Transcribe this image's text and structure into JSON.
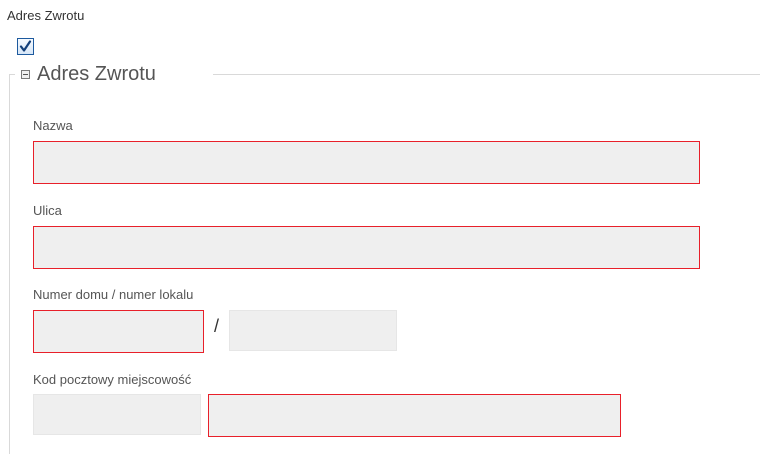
{
  "header": {
    "checkbox_label": "Adres Zwrotu",
    "checkbox_checked": true
  },
  "fieldset": {
    "legend": "Adres Zwrotu",
    "fields": {
      "nazwa": {
        "label": "Nazwa",
        "value": "",
        "required": true
      },
      "ulica": {
        "label": "Ulica",
        "value": "",
        "required": true
      },
      "numer": {
        "label": "Numer domu / numer lokalu",
        "separator": "/",
        "house_number": {
          "value": "",
          "required": true
        },
        "apartment_number": {
          "value": "",
          "required": false
        }
      },
      "kod": {
        "label": "Kod pocztowy miejscowość",
        "postal_code": {
          "value": "",
          "required": false
        },
        "city": {
          "value": "",
          "required": true
        }
      }
    }
  },
  "colors": {
    "required_border": "#e8202a",
    "input_background": "#efefef",
    "checkbox_border": "#1d5a9e",
    "checkmark": "#123f7a"
  }
}
